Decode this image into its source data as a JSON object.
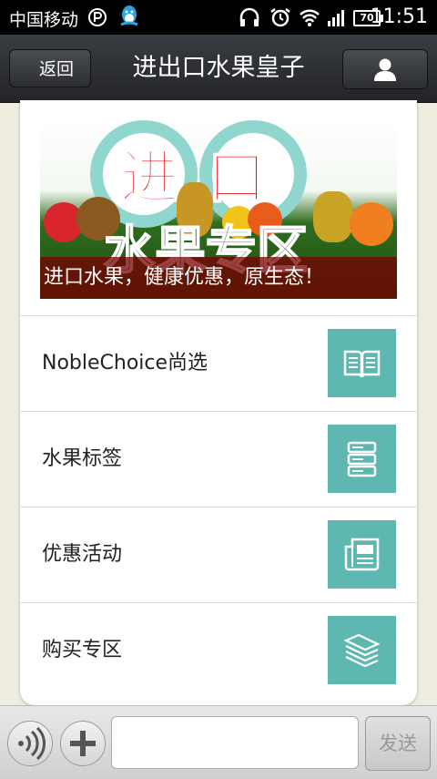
{
  "status_bar": {
    "carrier": "中国移动",
    "battery": "70",
    "time": "11:51",
    "icons": [
      "signal-p-icon",
      "qq-icon",
      "headphone-icon",
      "alarm-icon",
      "wifi-icon",
      "cell-signal-icon",
      "battery-icon"
    ]
  },
  "header": {
    "back_label": "返回",
    "title": "进出口水果皇子",
    "profile_icon": "person-icon"
  },
  "banner": {
    "headline_top": "进口",
    "headline_bottom": "水果专区",
    "caption": "进口水果，健康优惠，原生态！"
  },
  "menu": [
    {
      "label": "NobleChoice尚选",
      "icon": "book-icon"
    },
    {
      "label": "水果标签",
      "icon": "server-stack-icon"
    },
    {
      "label": "优惠活动",
      "icon": "newspaper-icon"
    },
    {
      "label": "购买专区",
      "icon": "paper-stack-icon"
    }
  ],
  "bottom_bar": {
    "voice_icon": "voice-icon",
    "plus_icon": "plus-icon",
    "input_value": "",
    "send_label": "发送"
  },
  "colors": {
    "tile": "#5fb7b2",
    "header": "#2c2e31",
    "background": "#efece0"
  }
}
